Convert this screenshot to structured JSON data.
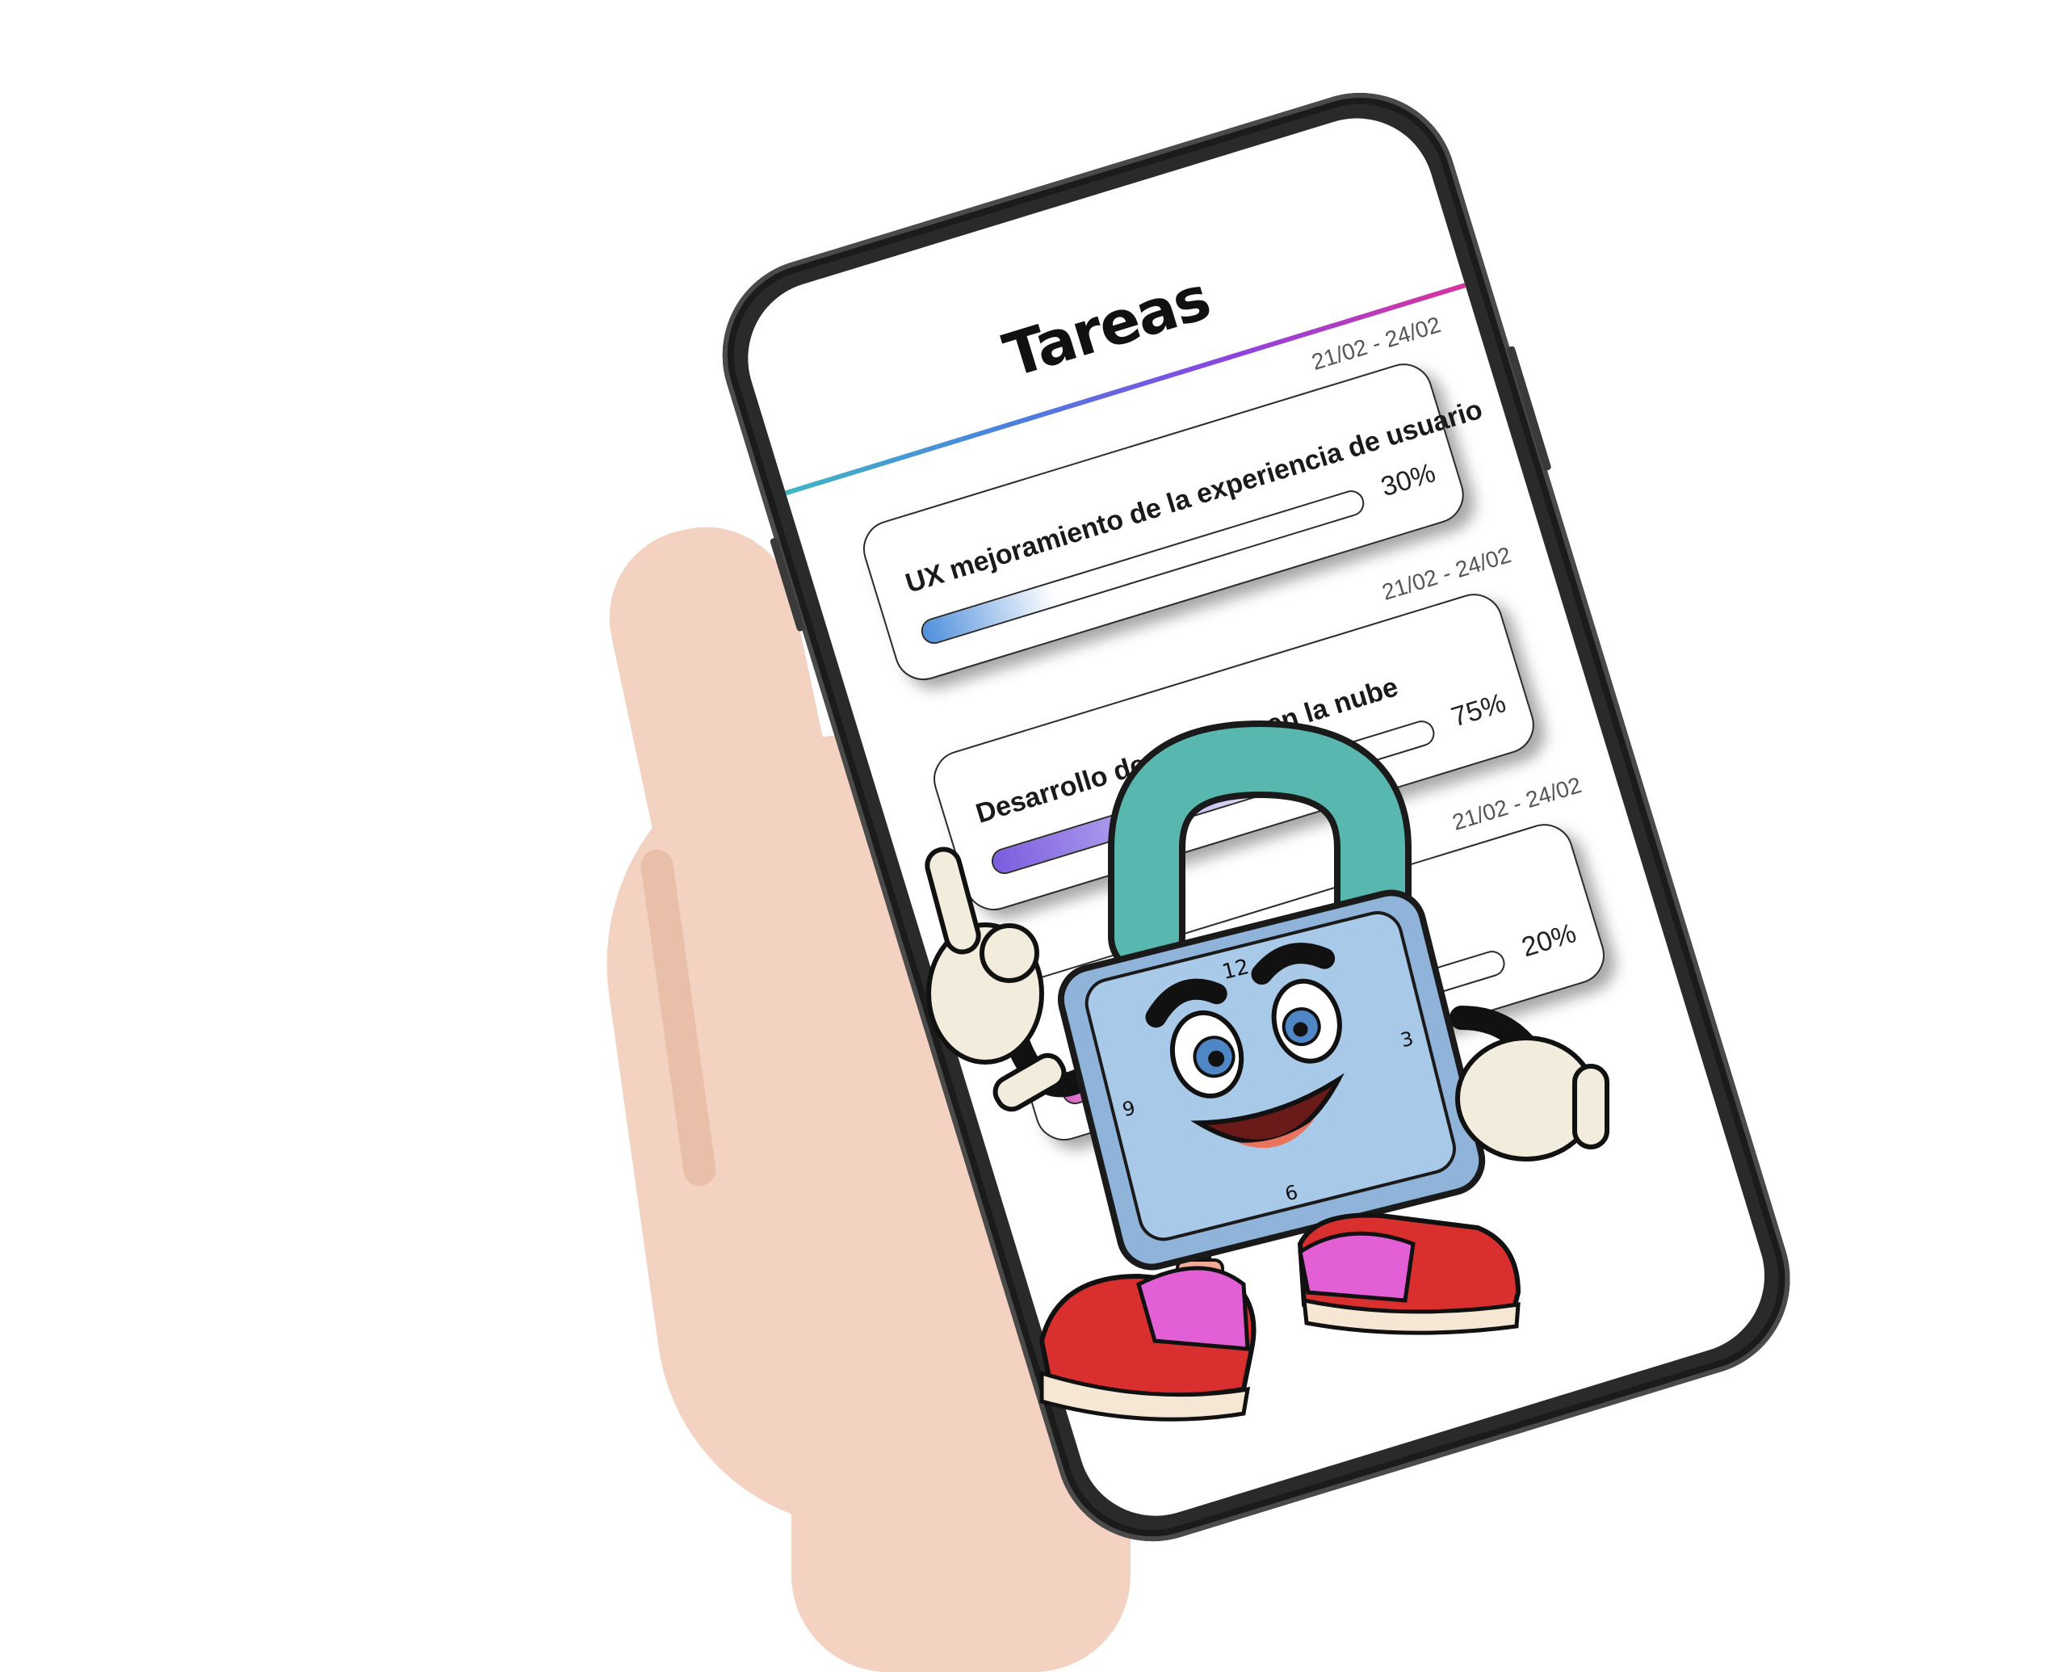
{
  "screen": {
    "title": "Tareas",
    "tasks": [
      {
        "date": "21/02 - 24/02",
        "name": "UX mejoramiento de la experiencia de usuario",
        "percent_label": "30%",
        "progress": 0.3,
        "color": "#4f8fdc"
      },
      {
        "date": "21/02 - 24/02",
        "name": "Desarrollo de software en la nube",
        "percent_label": "75%",
        "progress": 0.75,
        "color": "#7a5ce0"
      },
      {
        "date": "21/02 - 24/02",
        "name": "",
        "percent_label": "20%",
        "progress": 0.2,
        "color": "#d65fc3"
      }
    ]
  },
  "mascot": {
    "name": "padlock-mascot",
    "clock_numbers": [
      "12",
      "3",
      "6",
      "9"
    ],
    "colors": {
      "body": "#a9c9e8",
      "shackle": "#58b8b0",
      "shoe": "#d92f2f",
      "shoe_accent": "#e35fd6",
      "glove": "#f2ecdd"
    }
  }
}
